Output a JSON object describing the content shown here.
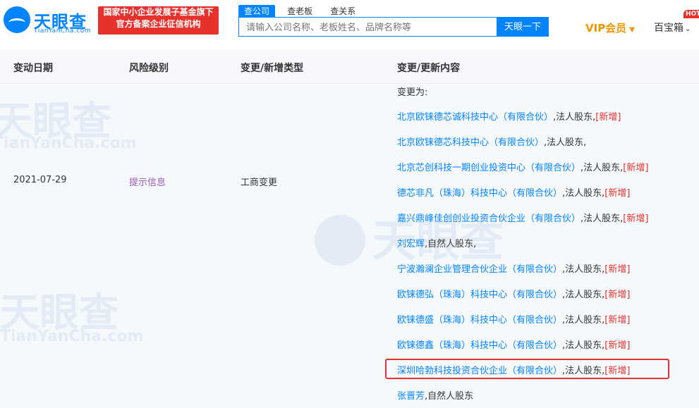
{
  "header": {
    "logo_cn": "天眼查",
    "logo_en": "TianYanCha.com",
    "badge_line1": "国家中小企业发展子基金旗下",
    "badge_line2": "官方备案企业征信机构",
    "tabs": [
      {
        "label": "查公司"
      },
      {
        "label": "查老板"
      },
      {
        "label": "查关系"
      }
    ],
    "search_placeholder": "请输入公司名称、老板姓名、品牌名称等",
    "search_button": "天眼一下",
    "vip_label": "VIP会员",
    "treasure_label": "百宝箱",
    "hot_badge": "HOT"
  },
  "table": {
    "headers": [
      "变动日期",
      "风险级别",
      "变更/新增类型",
      "变更/更新内容"
    ],
    "row": {
      "date": "2021-07-29",
      "risk": "提示信息",
      "type": "工商变更",
      "prefix": "变更为:",
      "entries": [
        {
          "name": "北京欧铼德芯诚科技中心（有限合伙）",
          "role": ",法人股东,",
          "tag": "[新增]",
          "link": true
        },
        {
          "name": "北京欧铼德芯科技中心（有限合伙）",
          "role": ",法人股东,",
          "tag": "",
          "link": true
        },
        {
          "name": "北京芯创科技一期创业投资中心（有限合伙）",
          "role": ",法人股东,",
          "tag": "[新增]",
          "link": true
        },
        {
          "name": "德芯非凡（珠海）科技中心（有限合伙）",
          "role": ",法人股东,",
          "tag": "[新增]",
          "link": true
        },
        {
          "name": "嘉兴鼎峰佳创创业投资合伙企业（有限合伙）",
          "role": ",法人股东,",
          "tag": "[新增]",
          "link": true
        },
        {
          "name": "刘宏辉",
          "role": ",自然人股东,",
          "tag": "",
          "link": true
        },
        {
          "name": "宁波瀚澜企业管理合伙企业（有限合伙）",
          "role": ",法人股东,",
          "tag": "[新增]",
          "link": true
        },
        {
          "name": "欧铼德弘（珠海）科技中心（有限合伙）",
          "role": ",法人股东,",
          "tag": "[新增]",
          "link": true
        },
        {
          "name": "欧铼德盛（珠海）科技中心（有限合伙）",
          "role": ",法人股东,",
          "tag": "[新增]",
          "link": true
        },
        {
          "name": "欧铼德鑫（珠海）科技中心（有限合伙）",
          "role": ",法人股东,",
          "tag": "[新增]",
          "link": true
        },
        {
          "name": "深圳哈勃科技投资合伙企业（有限合伙）",
          "role": ",法人股东,",
          "tag": "[新增]",
          "link": true
        },
        {
          "name": "张晋芳",
          "role": ",自然人股东",
          "tag": "",
          "link": true
        }
      ]
    }
  },
  "colors": {
    "brand_blue": "#0084ff",
    "accent_red": "#e6312d",
    "vip_orange": "#f29600",
    "risk_purple": "#9b59b6"
  }
}
